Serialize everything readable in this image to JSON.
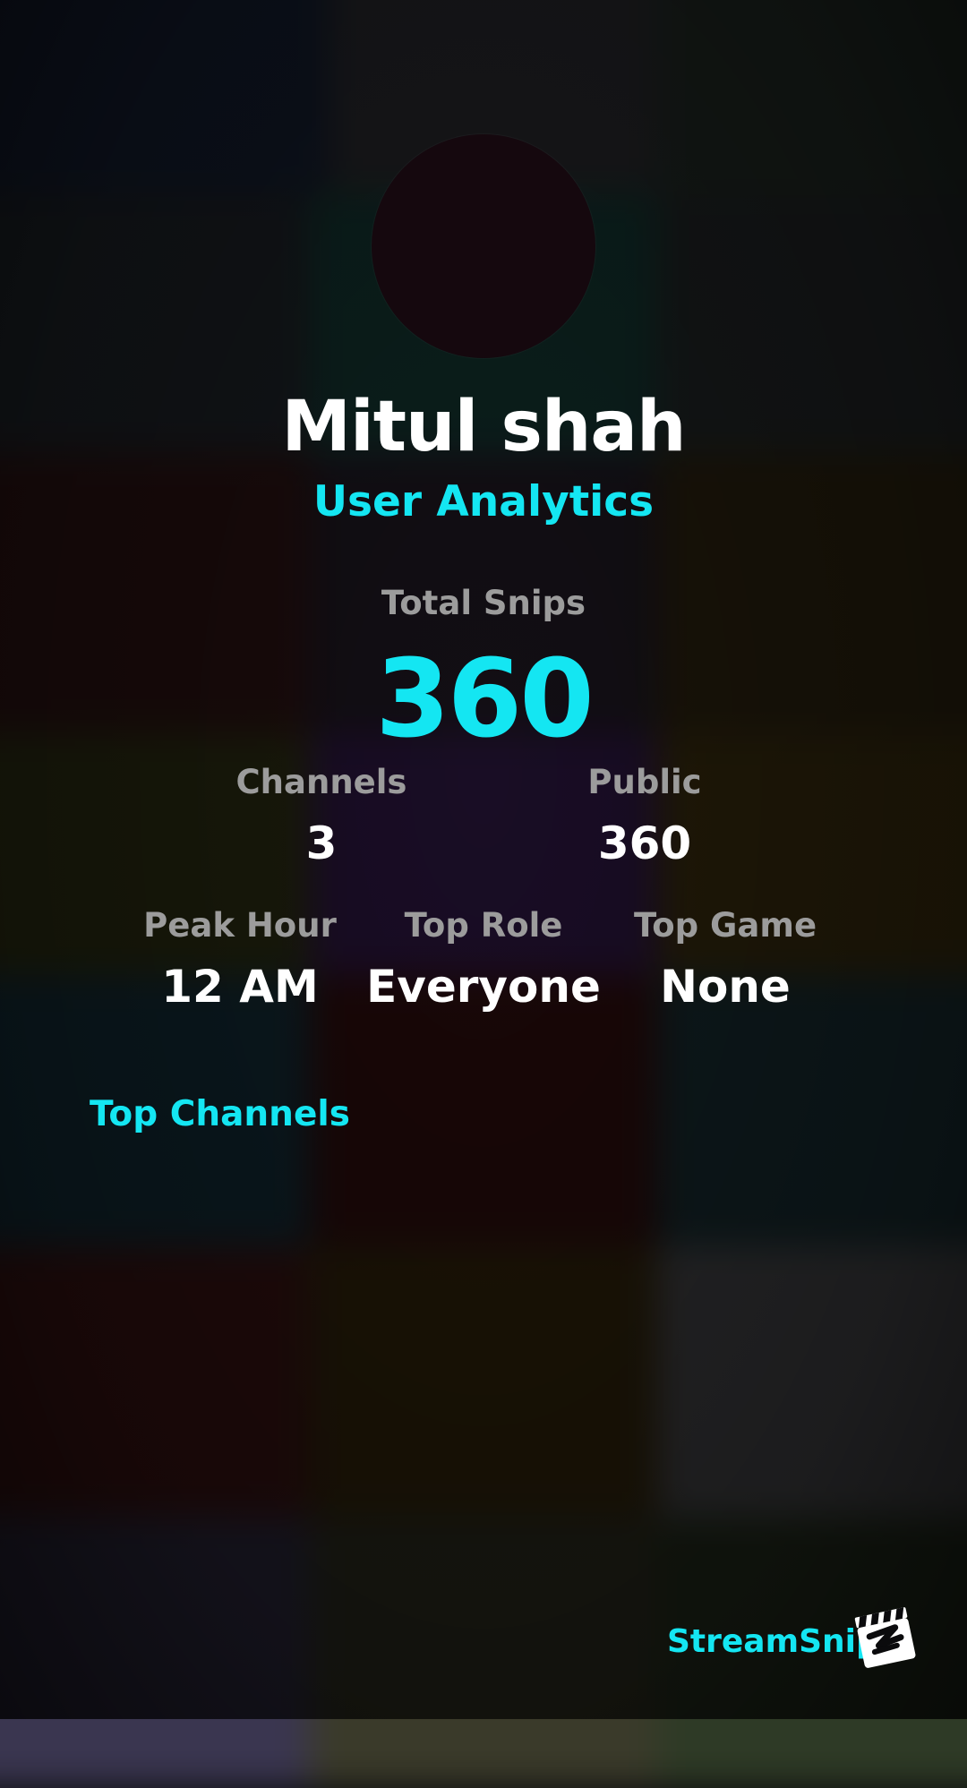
{
  "profile": {
    "name": "Mitul shah",
    "subtitle": "User Analytics"
  },
  "stats": {
    "total_snips_label": "Total Snips",
    "total_snips_value": "360",
    "channels_label": "Channels",
    "channels_value": "3",
    "public_label": "Public",
    "public_value": "360",
    "peak_hour_label": "Peak Hour",
    "peak_hour_value": "12 AM",
    "top_role_label": "Top Role",
    "top_role_value": "Everyone",
    "top_game_label": "Top Game",
    "top_game_value": "None"
  },
  "sections": {
    "top_channels_title": "Top Channels"
  },
  "brand": {
    "name": "StreamSnip"
  },
  "colors": {
    "accent": "#14e6f2",
    "label_gray": "#9c9c9c",
    "text_white": "#ffffff"
  },
  "icons": {
    "brand_logo": "clapperboard-icon"
  }
}
